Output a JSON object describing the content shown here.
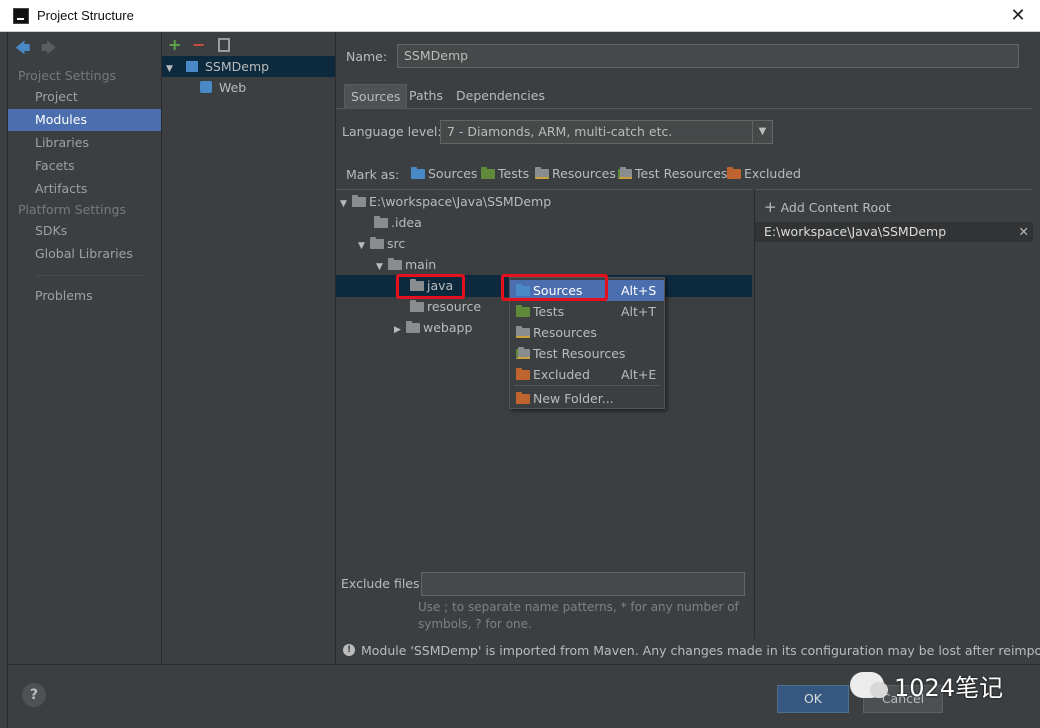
{
  "window": {
    "title": "Project Structure",
    "close": "✕"
  },
  "nav": {
    "project_settings_header": "Project Settings",
    "project_settings": [
      "Project",
      "Modules",
      "Libraries",
      "Facets",
      "Artifacts"
    ],
    "platform_settings_header": "Platform Settings",
    "platform_settings": [
      "SDKs",
      "Global Libraries"
    ],
    "problems": "Problems",
    "selected": "Modules"
  },
  "modules": {
    "items": [
      {
        "label": "SSMDemp",
        "expanded": true
      },
      {
        "label": "Web"
      }
    ]
  },
  "main": {
    "name_label": "Name:",
    "name_value": "SSMDemp",
    "tabs": [
      "Sources",
      "Paths",
      "Dependencies"
    ],
    "active_tab": "Sources",
    "language_level_label": "Language level:",
    "language_level_value": "7 - Diamonds, ARM, multi-catch etc.",
    "mark_as_label": "Mark as:",
    "mark_as": [
      "Sources",
      "Tests",
      "Resources",
      "Test Resources",
      "Excluded"
    ],
    "tree": [
      "E:\\workspace\\Java\\SSMDemp",
      ".idea",
      "src",
      "main",
      "java",
      "resource",
      "webapp"
    ],
    "add_content_root": "Add Content Root",
    "content_root_path": "E:\\workspace\\Java\\SSMDemp",
    "exclude_label": "Exclude files:",
    "exclude_value": "",
    "exclude_hint_1": "Use ; to separate name patterns, * for any number of",
    "exclude_hint_2": "symbols, ? for one.",
    "maven_notice": "Module 'SSMDemp' is imported from Maven. Any changes made in its configuration may be lost after reimporting."
  },
  "popup": {
    "items": [
      {
        "label": "Sources",
        "shortcut": "Alt+S"
      },
      {
        "label": "Tests",
        "shortcut": "Alt+T"
      },
      {
        "label": "Resources",
        "shortcut": ""
      },
      {
        "label": "Test Resources",
        "shortcut": ""
      },
      {
        "label": "Excluded",
        "shortcut": "Alt+E"
      },
      {
        "label": "New Folder...",
        "shortcut": ""
      }
    ]
  },
  "buttons": {
    "ok": "OK",
    "cancel": "Cancel",
    "help": "?"
  },
  "watermark": "1024笔记",
  "colors": {
    "selection": "#4b6eaf",
    "panel": "#3c3f41",
    "highlight_box": "#e4101e",
    "ok_button": "#365880"
  }
}
